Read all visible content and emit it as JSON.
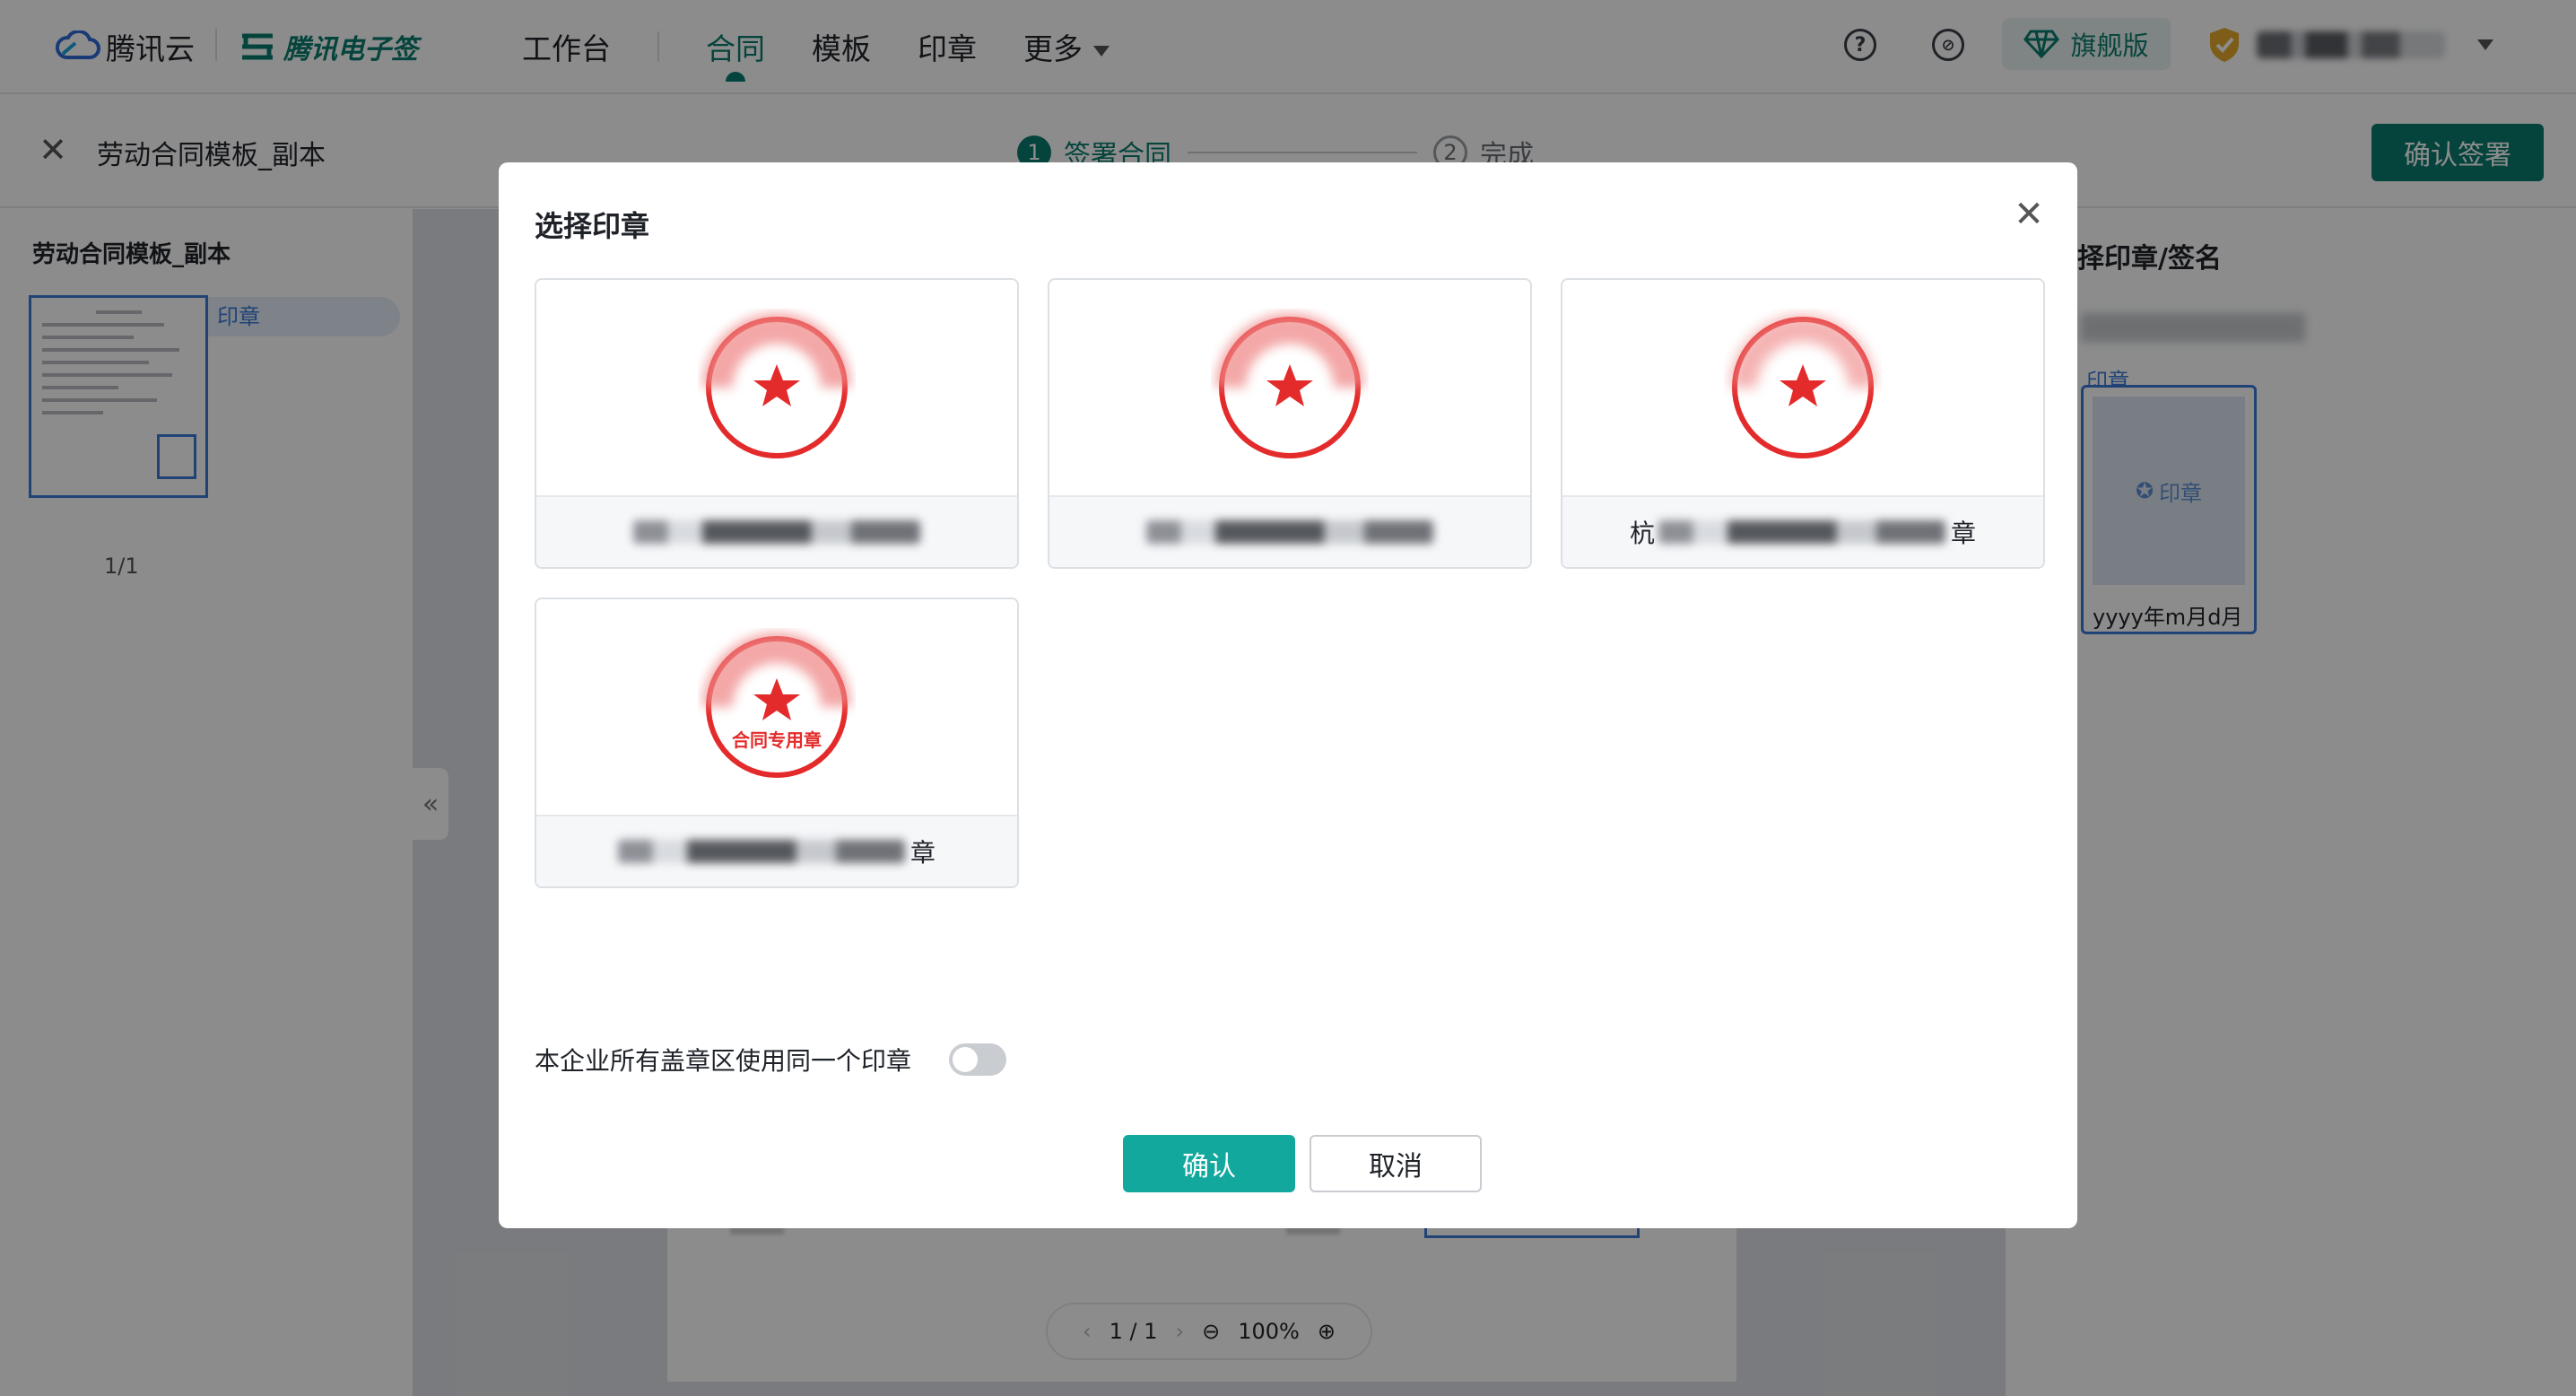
{
  "header": {
    "brand": "腾讯云",
    "product": "腾讯电子签",
    "nav": [
      "工作台",
      "合同",
      "模板",
      "印章",
      "更多"
    ],
    "active_nav": "合同",
    "edition": "旗舰版",
    "colors": {
      "brand": "#0a7d6e",
      "seal_red": "#e42b2b",
      "primary_button": "#13a89e"
    }
  },
  "subheader": {
    "doc_title": "劳动合同模板_副本",
    "steps": [
      {
        "num": "1",
        "label": "签署合同"
      },
      {
        "num": "2",
        "label": "完成"
      }
    ],
    "confirm_button": "确认签署"
  },
  "left_panel": {
    "title": "劳动合同模板_副本",
    "thumb_tag": "印章",
    "page_indicator": "1/1"
  },
  "right_panel": {
    "title": "择印章/签名",
    "field_label": "印章",
    "card_placeholder": "印章",
    "date_format": "yyyy年m月d月"
  },
  "viewer": {
    "page": "1 / 1",
    "zoom": "100%"
  },
  "modal": {
    "title": "选择印章",
    "seals": [
      {
        "name_prefix": "",
        "name_suffix": "",
        "seal_text": ""
      },
      {
        "name_prefix": "",
        "name_suffix": "",
        "seal_text": ""
      },
      {
        "name_prefix": "杭",
        "name_suffix": "章",
        "seal_text": ""
      },
      {
        "name_prefix": "",
        "name_suffix": "章",
        "seal_text": "合同专用章"
      }
    ],
    "toggle_label": "本企业所有盖章区使用同一个印章",
    "toggle_on": false,
    "ok_button": "确认",
    "cancel_button": "取消"
  }
}
